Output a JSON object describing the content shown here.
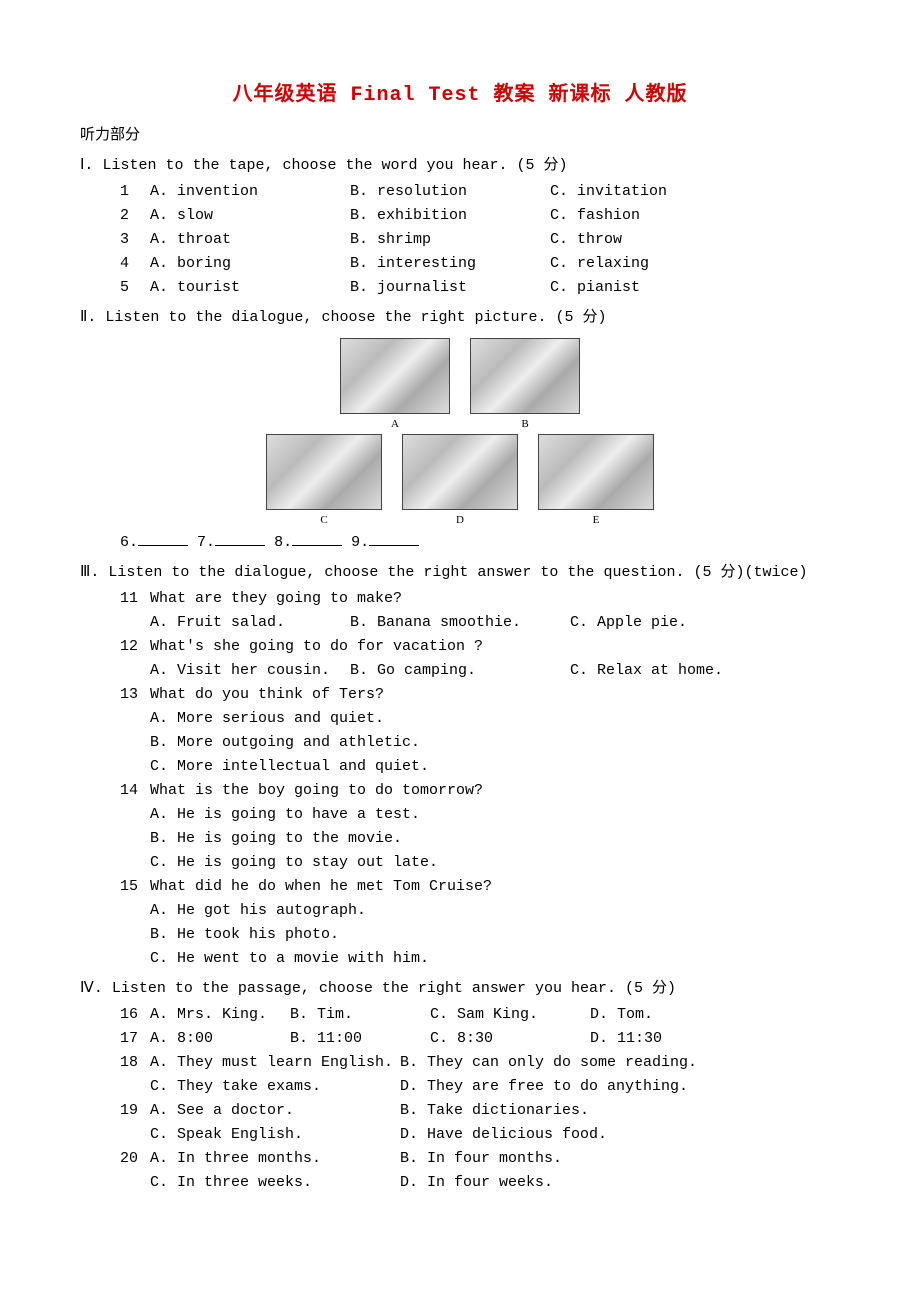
{
  "title": "八年级英语 Final Test 教案 新课标 人教版",
  "listening_heading": "听力部分",
  "sec1": {
    "roman": "Ⅰ.",
    "instr": "Listen to the tape, choose the word you hear. (5 分)",
    "rows": [
      {
        "n": "1",
        "a": "A. invention",
        "b": "B. resolution",
        "c": "C. invitation"
      },
      {
        "n": "2",
        "a": "A. slow",
        "b": "B. exhibition",
        "c": "C. fashion"
      },
      {
        "n": "3",
        "a": "A. throat",
        "b": "B. shrimp",
        "c": "C. throw"
      },
      {
        "n": "4",
        "a": "A. boring",
        "b": "B. interesting",
        "c": "C. relaxing"
      },
      {
        "n": "5",
        "a": "A. tourist",
        "b": "B. journalist",
        "c": "C. pianist"
      }
    ]
  },
  "sec2": {
    "roman": "Ⅱ.",
    "instr": "Listen to the dialogue, choose the right picture. (5 分)",
    "labels_top": [
      "A",
      "B"
    ],
    "labels_bottom": [
      "C",
      "D",
      "E"
    ],
    "fill_line_a": "6.",
    "fill_line_b": "7.",
    "fill_line_c": "8.",
    "fill_line_d": "9."
  },
  "sec3": {
    "roman": "Ⅲ.",
    "instr": "Listen to the dialogue, choose the right answer to the question. (5 分)(twice)",
    "q11": {
      "n": "11",
      "stem": "What are they going to make?",
      "a": "A. Fruit salad.",
      "b": "B. Banana smoothie.",
      "c": "C. Apple pie."
    },
    "q12": {
      "n": "12",
      "stem": "What's she going to do for vacation ?",
      "a": "A. Visit her cousin.",
      "b": "B. Go camping.",
      "c": "C. Relax at home."
    },
    "q13": {
      "n": "13",
      "stem": "What do you think of Ters?",
      "a": "A. More serious and quiet.",
      "b": "B. More outgoing and athletic.",
      "c": "C. More intellectual and quiet."
    },
    "q14": {
      "n": "14",
      "stem": "What is the boy going to do tomorrow?",
      "a": "A. He is going to have a test.",
      "b": "B. He is going to the movie.",
      "c": "C. He is going to stay out late."
    },
    "q15": {
      "n": "15",
      "stem": "What did he do when he met Tom Cruise?",
      "a": "A. He got his autograph.",
      "b": "B. He took his photo.",
      "c": "C. He went to a movie with him."
    }
  },
  "sec4": {
    "roman": "Ⅳ.",
    "instr": "Listen to the passage, choose the right answer you hear. (5 分)",
    "q16": {
      "n": "16",
      "a": "A. Mrs. King.",
      "b": "B. Tim.",
      "c": "C. Sam King.",
      "d": "D. Tom."
    },
    "q17": {
      "n": "17",
      "a": "A. 8:00",
      "b": "B. 11:00",
      "c": "C. 8:30",
      "d": "D. 11:30"
    },
    "q18": {
      "n": "18",
      "a": "A. They must learn English.",
      "b": "B. They can only do some reading.",
      "c": "C. They take exams.",
      "d": "D. They are free to do anything."
    },
    "q19": {
      "n": "19",
      "a": "A. See a doctor.",
      "b": "B. Take dictionaries.",
      "c": "C. Speak English.",
      "d": "D. Have delicious food."
    },
    "q20": {
      "n": "20",
      "a": "A. In three months.",
      "b": "B. In four months.",
      "c": " C. In three weeks.",
      "d": "D. In four weeks."
    }
  }
}
